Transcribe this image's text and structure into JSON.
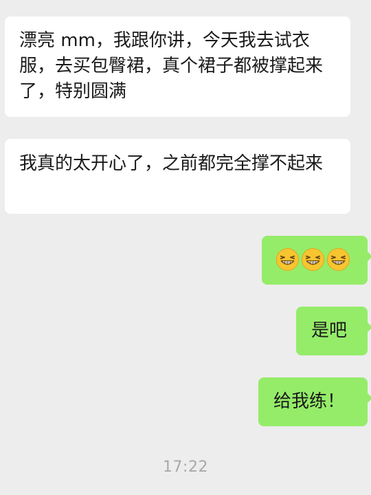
{
  "messages": [
    {
      "side": "incoming",
      "text": "漂亮 mm，我跟你讲，今天我去试衣服，去买包臀裙，真个裙子都被撑起来了，特别圆满"
    },
    {
      "side": "incoming",
      "text": "我真的太开心了，之前都完全撑不起来"
    },
    {
      "side": "outgoing",
      "emojis": [
        "grin-emoji",
        "grin-emoji",
        "grin-emoji"
      ]
    },
    {
      "side": "outgoing",
      "text": "是吧"
    },
    {
      "side": "outgoing",
      "text": "给我练！"
    }
  ],
  "timestamp": "17:22",
  "colors": {
    "background": "#ededed",
    "incoming_bubble": "#ffffff",
    "outgoing_bubble": "#95ec69",
    "text": "#1a1a1a",
    "timestamp": "#a8a8a8"
  }
}
